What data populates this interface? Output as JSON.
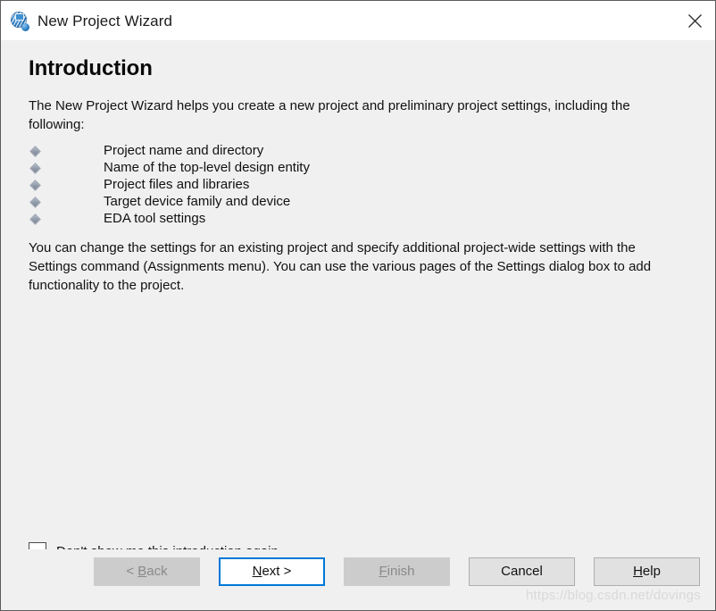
{
  "window": {
    "title": "New Project Wizard",
    "icon": "quartus-globe-icon",
    "close_label": "✕",
    "accent_color": "#0078d7",
    "body_color": "#f0f0f0",
    "titlebar_color": "#ffffff"
  },
  "page": {
    "heading": "Introduction",
    "intro_paragraph": "The New Project Wizard helps you create a new project and preliminary project settings, including the following:",
    "bullets": [
      "Project name and directory",
      "Name of the top-level design entity",
      "Project files and libraries",
      "Target device family and device",
      "EDA tool settings"
    ],
    "closing_paragraph": "You can change the settings for an existing project and specify additional project-wide settings with the Settings command (Assignments menu). You can use the various pages of the Settings dialog box to add functionality to the project."
  },
  "checkbox": {
    "checked": false,
    "label_mnemonic": "D",
    "label_rest": "on't show me this introduction again"
  },
  "footer": {
    "buttons": [
      {
        "label": "< Back",
        "mnemonic": "B",
        "state": "disabled",
        "name": "back-button"
      },
      {
        "label": "Next >",
        "mnemonic": "N",
        "state": "default",
        "name": "next-button"
      },
      {
        "label": "Finish",
        "mnemonic": "F",
        "state": "disabled",
        "name": "finish-button"
      },
      {
        "label": "Cancel",
        "mnemonic": "",
        "state": "enabled",
        "name": "cancel-button"
      },
      {
        "label": "Help",
        "mnemonic": "H",
        "state": "enabled",
        "name": "help-button"
      }
    ]
  },
  "watermark": {
    "text": "https://blog.csdn.net/dovings"
  }
}
